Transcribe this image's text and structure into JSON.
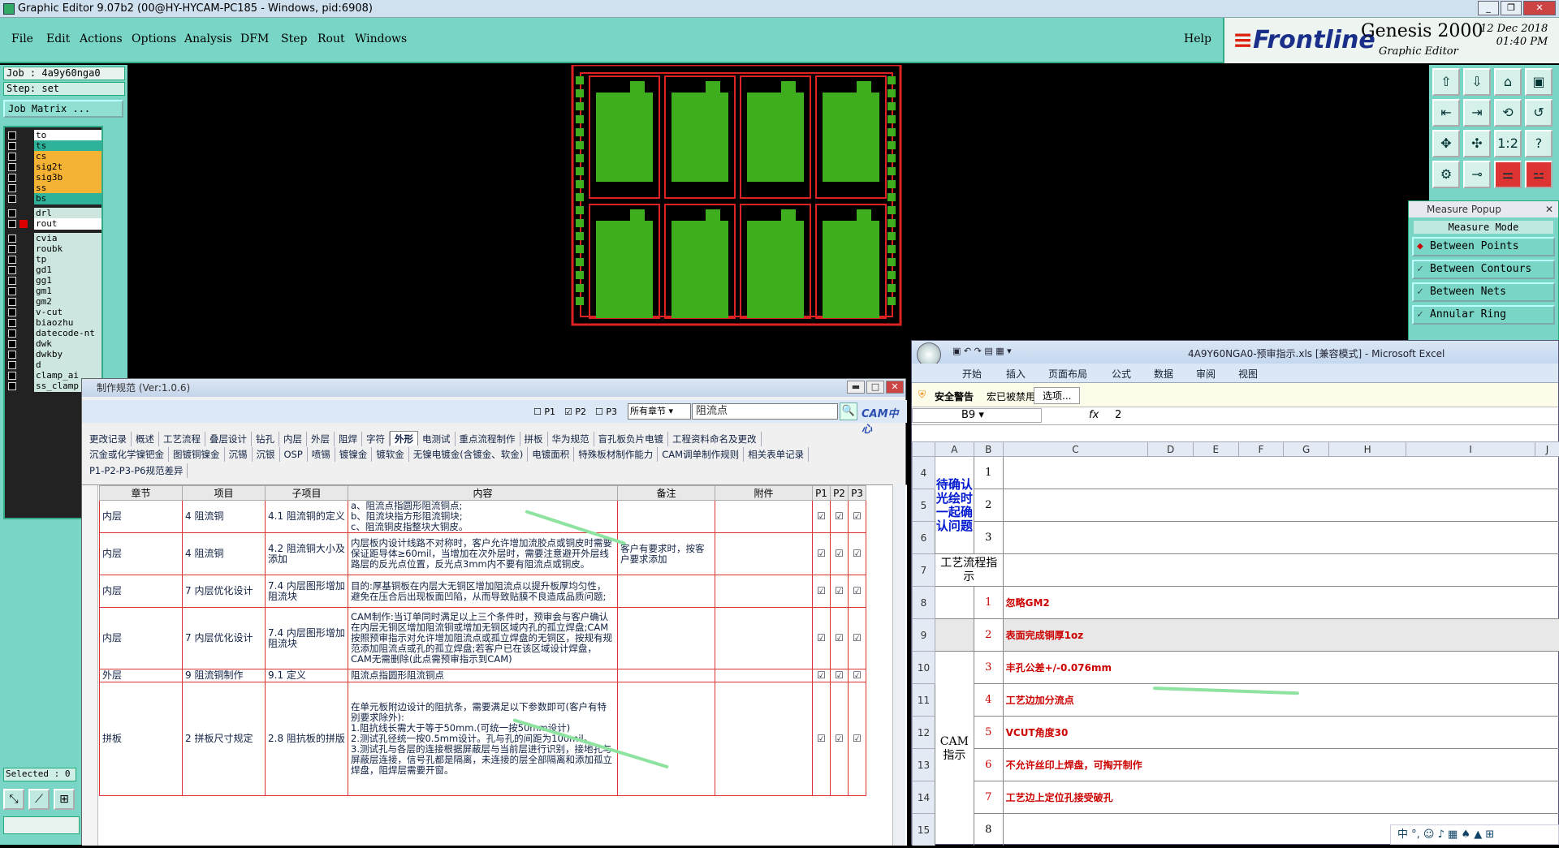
{
  "titlebar": {
    "title": "Graphic Editor 9.07b2 (00@HY-HYCAM-PC185 - Windows, pid:6908)"
  },
  "menu": [
    "File",
    "Edit",
    "Actions",
    "Options",
    "Analysis",
    "DFM",
    "Step",
    "Rout",
    "Windows"
  ],
  "help": "Help",
  "brand": {
    "logo": "Frontline",
    "product": "Genesis 2000",
    "sub": "Graphic Editor",
    "date": "12 Dec 2018",
    "time": "01:40 PM"
  },
  "job": {
    "job": "Job : 4a9y60nga0",
    "step": "Step: set",
    "matrix": "Job Matrix ..."
  },
  "layers": [
    {
      "name": "to",
      "color": "#ffffff"
    },
    {
      "name": "ts",
      "color": "#2eb39a"
    },
    {
      "name": "cs",
      "color": "#f5b335"
    },
    {
      "name": "sig2t",
      "color": "#f5b335"
    },
    {
      "name": "sig3b",
      "color": "#f5b335"
    },
    {
      "name": "ss",
      "color": "#f5b335"
    },
    {
      "name": "bs",
      "color": "#2eb39a"
    },
    {
      "name": "drl",
      "color": "#cde7e0"
    },
    {
      "name": "rout",
      "color": "#ffffff"
    },
    {
      "name": "cvia",
      "color": "#cde7e0"
    },
    {
      "name": "roubk",
      "color": "#cde7e0"
    },
    {
      "name": "tp",
      "color": "#cde7e0"
    },
    {
      "name": "gd1",
      "color": "#cde7e0"
    },
    {
      "name": "gg1",
      "color": "#cde7e0"
    },
    {
      "name": "gm1",
      "color": "#cde7e0"
    },
    {
      "name": "gm2",
      "color": "#cde7e0"
    },
    {
      "name": "v-cut",
      "color": "#cde7e0"
    },
    {
      "name": "biaozhu",
      "color": "#cde7e0"
    },
    {
      "name": "datecode-nt",
      "color": "#cde7e0"
    },
    {
      "name": "dwk",
      "color": "#cde7e0"
    },
    {
      "name": "dwkby",
      "color": "#cde7e0"
    },
    {
      "name": "d",
      "color": "#cde7e0"
    },
    {
      "name": "clamp_ai",
      "color": "#cde7e0"
    },
    {
      "name": "ss_clamp",
      "color": "#cde7e0"
    }
  ],
  "selected": "Selected : 0",
  "measure": {
    "title": "Measure Popup",
    "mode": "Measure Mode",
    "options": [
      "Between Points",
      "Between Contours",
      "Between Nets",
      "Annular Ring"
    ]
  },
  "spec": {
    "title": "制作规范 (Ver:1.0.6)",
    "checks": [
      "P1",
      "P2",
      "P3"
    ],
    "chapter": "所有章节",
    "search": "阻流点",
    "cam_logo": "CAM中心",
    "tabs1": [
      "更改记录",
      "概述",
      "工艺流程",
      "叠层设计",
      "钻孔",
      "内层",
      "外层",
      "阻焊",
      "字符",
      "外形",
      "电测试",
      "重点流程制作",
      "拼板",
      "华为规范",
      "盲孔板负片电镀",
      "工程资料命名及更改"
    ],
    "tabs2": [
      "沉金或化学镍钯金",
      "图镀铜镍金",
      "沉锡",
      "沉银",
      "OSP",
      "喷锡",
      "镀镍金",
      "镀软金",
      "无镍电镀金(含镀金、软金)",
      "电镀面积",
      "特殊板材制作能力",
      "CAM调单制作规则",
      "相关表单记录"
    ],
    "tabs3": [
      "P1-P2-P3-P6规范差异"
    ],
    "headers": [
      "章节",
      "项目",
      "子项目",
      "内容",
      "备注",
      "附件",
      "P1",
      "P2",
      "P3"
    ],
    "rows": [
      {
        "chapter": "内层",
        "item": "4 阻流铜",
        "sub": "4.1 阻流铜的定义",
        "content": "a、阻流点指圆形阻流铜点;\nb、阻流块指方形阻流铜块;\nc、阻流铜皮指整块大铜皮。",
        "note": "",
        "h": 40
      },
      {
        "chapter": "内层",
        "item": "4 阻流铜",
        "sub": "4.2 阻流铜大小及添加",
        "content": "内层板内设计线路不对称时，客户允许增加流胶点或铜皮时需要保证距导体≥60mil，当增加在次外层时，需要注意避开外层线路层的反光点位置，反光点3mm内不要有阻流点或铜皮。",
        "note": "客户有要求时，按客户要求添加",
        "h": 52
      },
      {
        "chapter": "内层",
        "item": "7 内层优化设计",
        "sub": "7.4 内层图形增加阻流块",
        "content": "目的:厚基铜板在内层大无铜区增加阻流点以提升板厚均匀性，避免在压合后出现板面凹陷，从而导致贴膜不良造成品质问题;",
        "note": "",
        "h": 40
      },
      {
        "chapter": "内层",
        "item": "7 内层优化设计",
        "sub": "7.4 内层图形增加阻流块",
        "content": "CAM制作:当订单同时满足以上三个条件时，预审会与客户确认在内层无铜区增加阻流铜或增加无铜区域内孔的孤立焊盘;CAM按照预审指示对允许增加阻流点或孤立焊盘的无铜区，按规有规范添加阻流点或孔的孤立焊盘;若客户已在该区域设计焊盘，CAM无需删除(此点需预审指示到CAM)",
        "note": "",
        "h": 76
      },
      {
        "chapter": "外层",
        "item": "9 阻流铜制作",
        "sub": "9.1 定义",
        "content": "阻流点指圆形阻流铜点",
        "note": "",
        "h": 16
      },
      {
        "chapter": "拼板",
        "item": "2 拼板尺寸规定",
        "sub": "2.8 阻抗板的拼版",
        "content": "在单元板附边设计的阻抗条，需要满足以下参数即可(客户有特别要求除外):\n1.阻抗线长需大于等于50mm.(可统一按50mm设计)\n2.测试孔径统一按0.5mm设计。孔与孔的间距为100mil。\n3.测试孔与各层的连接根据屏蔽层与当前层进行识别，接地孔与屏蔽层连接，信号孔都是隔离，未连接的层全部隔离和添加孤立焊盘，阻焊层需要开窗。",
        "note": "",
        "h": 140
      }
    ]
  },
  "excel": {
    "title": "4A9Y60NGA0-预审指示.xls [兼容模式] - Microsoft Excel",
    "ribbon": [
      "开始",
      "插入",
      "页面布局",
      "公式",
      "数据",
      "审阅",
      "视图"
    ],
    "warning": "安全警告",
    "warning_msg": "宏已被禁用。",
    "options_btn": "选项...",
    "cellref": "B9",
    "formula": "2",
    "cols": [
      "A",
      "B",
      "C",
      "D",
      "E",
      "F",
      "G",
      "H",
      "I",
      "J"
    ],
    "confirm_label": "待确认光绘时一起确认问题",
    "flow_label": "工艺流程指示",
    "cam_label": "CAM指示",
    "rows": [
      {
        "row": "4",
        "num": "1",
        "text": ""
      },
      {
        "row": "5",
        "num": "2",
        "text": ""
      },
      {
        "row": "6",
        "num": "3",
        "text": ""
      },
      {
        "row": "7",
        "num": "",
        "text": ""
      },
      {
        "row": "8",
        "num": "1",
        "text": "忽略GM2"
      },
      {
        "row": "9",
        "num": "2",
        "text": "表面完成铜厚1oz"
      },
      {
        "row": "10",
        "num": "3",
        "text": "丰孔公差+/-0.076mm"
      },
      {
        "row": "11",
        "num": "4",
        "text": "工艺边加分流点"
      },
      {
        "row": "12",
        "num": "5",
        "text": "VCUT角度30"
      },
      {
        "row": "13",
        "num": "6",
        "text": "不允许丝印上焊盘，可掏开制作"
      },
      {
        "row": "14",
        "num": "7",
        "text": "工艺边上定位孔接受破孔"
      },
      {
        "row": "15",
        "num": "8",
        "text": ""
      }
    ]
  },
  "ime": "中 °, ☺ ♪ ▦ ♠ ▲ ⊞"
}
